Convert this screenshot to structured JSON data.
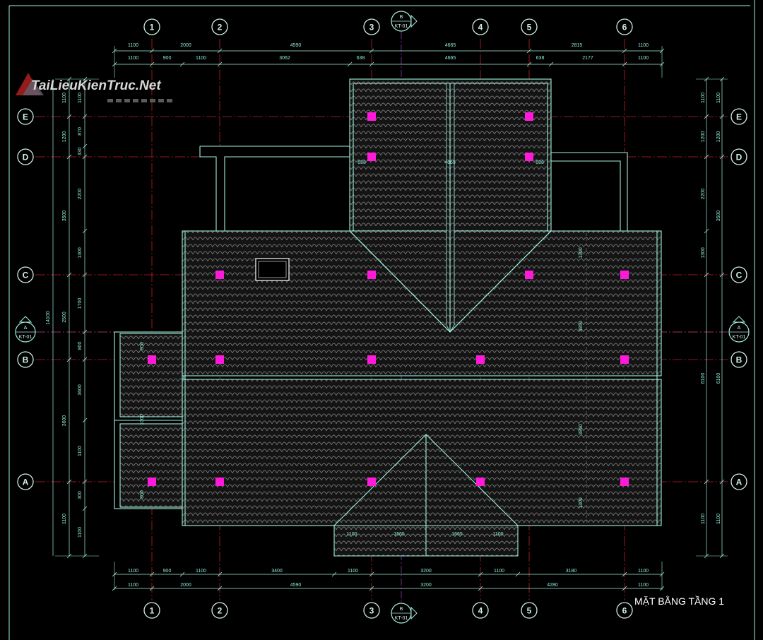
{
  "drawing": {
    "title": "MẶT BẰNG TẦNG 1",
    "watermark": "TaiLieuKienTruc.Net",
    "section_marker_b": {
      "letter": "B",
      "ref": "KT-01"
    },
    "section_marker_a": {
      "letter": "A",
      "ref": "KT-01"
    },
    "colors": {
      "background": "#000000",
      "line": "#9ff0dc",
      "grid_axis": "#c0202a",
      "column": "#ff1ad9",
      "dim": "#8fe8d8",
      "tile": "#6a6a6a",
      "roof_fill": "#151515"
    }
  },
  "grid_columns": [
    "1",
    "2",
    "3",
    "4",
    "5",
    "6"
  ],
  "grid_rows": [
    "E",
    "D",
    "C",
    "B",
    "A"
  ],
  "dimensions": {
    "top_outer": [
      "1100",
      "2000",
      "4590",
      "4665",
      "2815",
      "1100"
    ],
    "top_inner": [
      "1100",
      "900",
      "1100",
      "3062",
      "638",
      "4665",
      "638",
      "2177",
      "1100"
    ],
    "bottom_inner": [
      "1100",
      "900",
      "1100",
      "3400",
      "1100",
      "3200",
      "1100",
      "3180",
      "1100"
    ],
    "bottom_outer": [
      "1100",
      "2000",
      "4590",
      "3200",
      "4280",
      "1100"
    ],
    "left_outer": [
      "1100",
      "1200",
      "3500",
      "2500",
      "3600",
      "1100"
    ],
    "left_inner": [
      "1100",
      "870",
      "330",
      "2200",
      "1300",
      "1700",
      "800",
      "3600",
      "1100",
      "300",
      "1100"
    ],
    "left_total": "14100",
    "right_outer": [
      "1100",
      "1200",
      "3500",
      "6100",
      "1100"
    ],
    "right_inner": [
      "1100",
      "1200",
      "2200",
      "1300",
      "6100",
      "1100"
    ],
    "roof_internal": [
      "638",
      "4665",
      "638",
      "1300",
      "3950",
      "3950",
      "1300",
      "800",
      "1000",
      "800",
      "1100",
      "1665",
      "1665",
      "1100"
    ]
  }
}
